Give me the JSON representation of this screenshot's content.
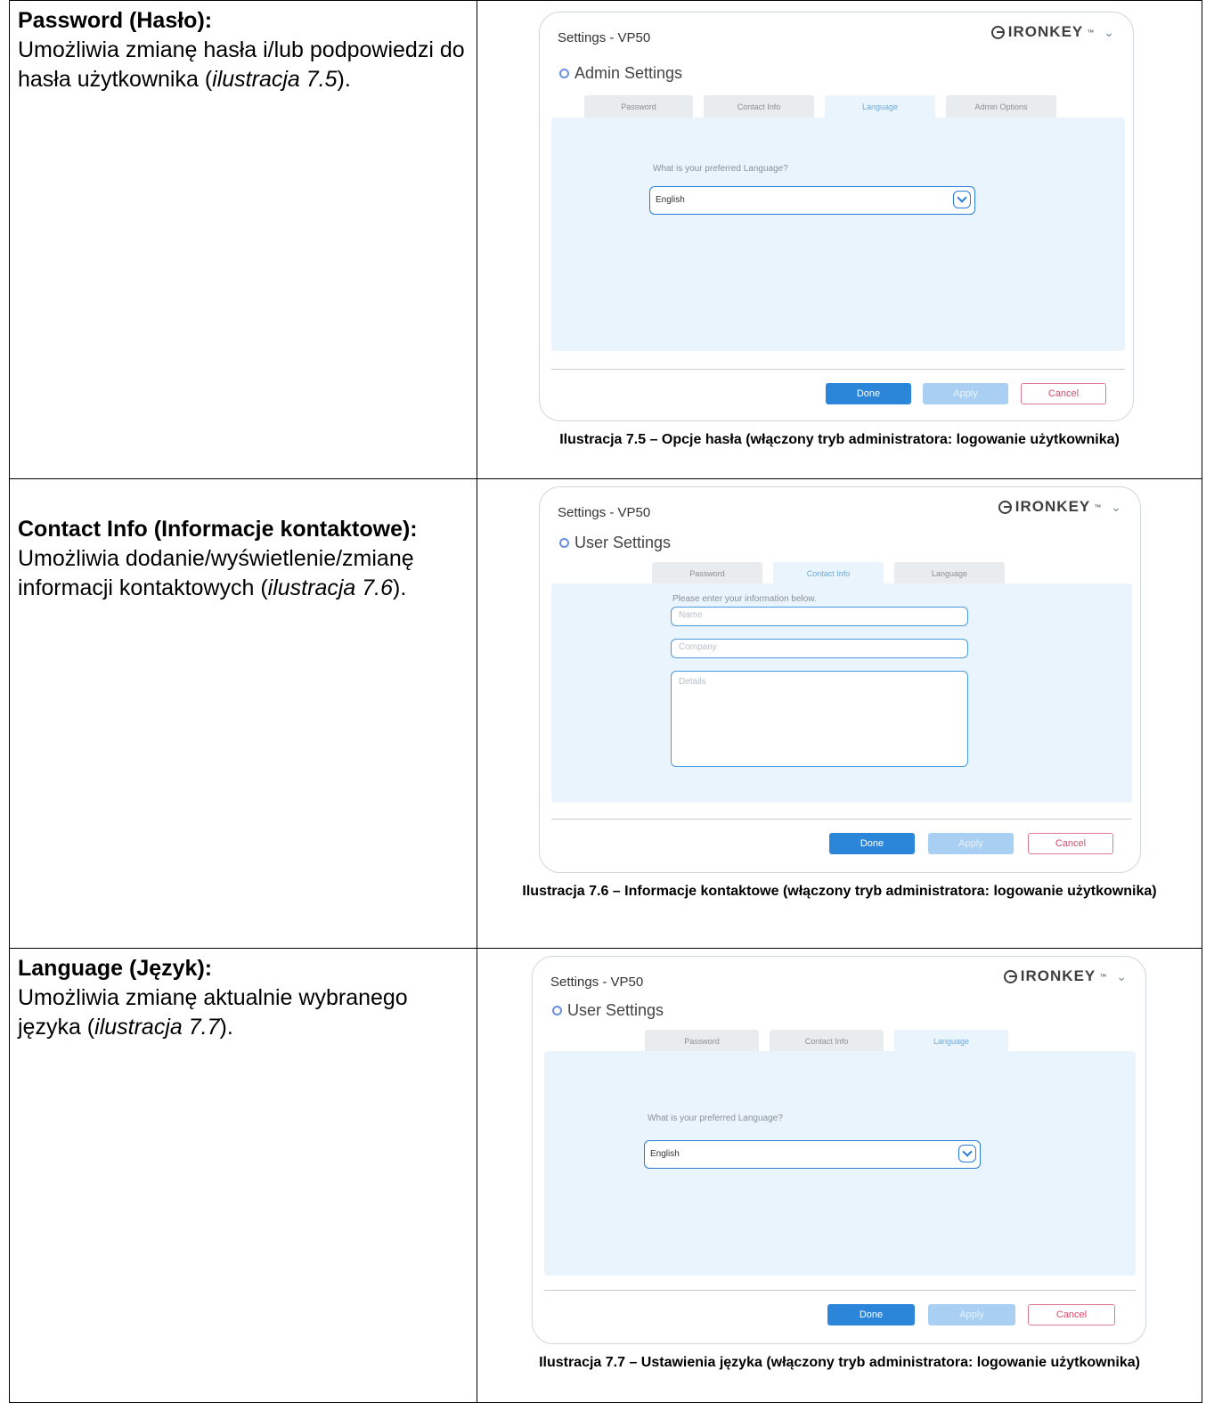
{
  "rows": [
    {
      "term": "Password (Hasło):",
      "desc_pre": "Umożliwia zmianę hasła i/lub podpowiedzi do hasła użytkownika (",
      "desc_ref": "ilustracja 7.5",
      "desc_post": ").",
      "screenshot": {
        "title": "Settings - VP50",
        "logo": "IRONKEY",
        "heading": "Admin Settings",
        "tabs": [
          "Password",
          "Contact Info",
          "Language",
          "Admin Options"
        ],
        "prompt": "What is your preferred Language?",
        "select_value": "English",
        "buttons": {
          "done": "Done",
          "apply": "Apply",
          "cancel": "Cancel"
        }
      },
      "caption": "Ilustracja 7.5 – Opcje hasła (włączony tryb administratora: logowanie użytkownika)"
    },
    {
      "term": "Contact Info (Informacje kontaktowe):",
      "desc_pre": "Umożliwia dodanie/wyświetlenie/zmianę informacji kontaktowych (",
      "desc_ref": "ilustracja 7.6",
      "desc_post": ").",
      "screenshot": {
        "title": "Settings - VP50",
        "logo": "IRONKEY",
        "heading": "User Settings",
        "tabs": [
          "Password",
          "Contact Info",
          "Language"
        ],
        "prompt": "Please enter your information below.",
        "fields": {
          "name": "Name",
          "company": "Company",
          "details": "Details"
        },
        "buttons": {
          "done": "Done",
          "apply": "Apply",
          "cancel": "Cancel"
        }
      },
      "caption": "Ilustracja 7.6 – Informacje kontaktowe (włączony tryb administratora: logowanie użytkownika)"
    },
    {
      "term": "Language (Język):",
      "desc_pre": "Umożliwia zmianę aktualnie wybranego języka (",
      "desc_ref": "ilustracja 7.7",
      "desc_post": ").",
      "screenshot": {
        "title": "Settings - VP50",
        "logo": "IRONKEY",
        "heading": "User Settings",
        "tabs": [
          "Password",
          "Contact Info",
          "Language"
        ],
        "prompt": "What is your preferred Language?",
        "select_value": "English",
        "buttons": {
          "done": "Done",
          "apply": "Apply",
          "cancel": "Cancel"
        }
      },
      "caption": "Ilustracja 7.7 – Ustawienia języka (włączony tryb administratora: logowanie użytkownika)"
    }
  ]
}
